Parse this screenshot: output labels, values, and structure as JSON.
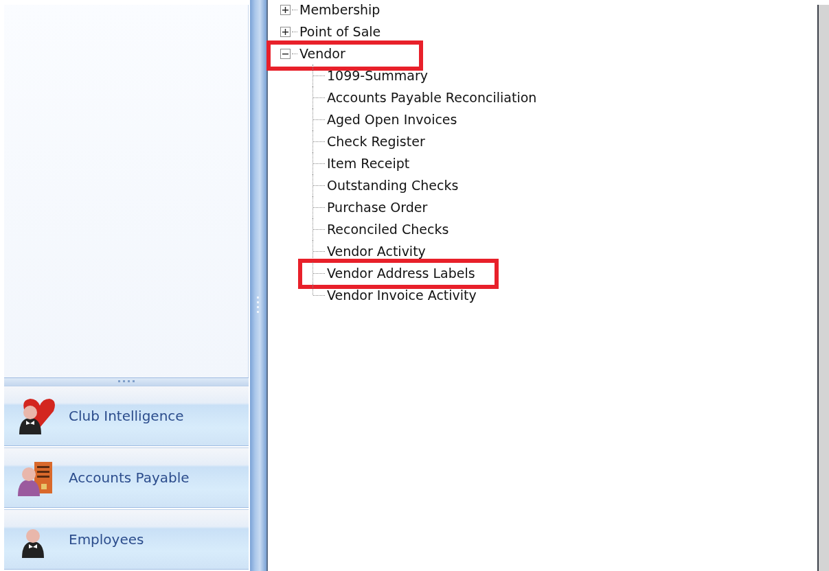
{
  "tree": [
    {
      "label": "Membership",
      "expanded": false,
      "highlighted": false
    },
    {
      "label": "Point of Sale",
      "expanded": false,
      "highlighted": false
    },
    {
      "label": "Vendor",
      "expanded": true,
      "highlighted": true,
      "children": [
        {
          "label": "1099-Summary",
          "highlighted": false
        },
        {
          "label": "Accounts Payable Reconciliation",
          "highlighted": false
        },
        {
          "label": "Aged Open Invoices",
          "highlighted": false
        },
        {
          "label": "Check Register",
          "highlighted": false
        },
        {
          "label": "Item Receipt",
          "highlighted": false
        },
        {
          "label": "Outstanding Checks",
          "highlighted": false
        },
        {
          "label": "Purchase Order",
          "highlighted": false
        },
        {
          "label": "Reconciled Checks",
          "highlighted": false
        },
        {
          "label": "Vendor Activity",
          "highlighted": false
        },
        {
          "label": "Vendor Address Labels",
          "highlighted": true
        },
        {
          "label": "Vendor Invoice Activity",
          "highlighted": false
        }
      ]
    }
  ],
  "nav_buttons": [
    {
      "label": "Club Intelligence",
      "kind": "heart"
    },
    {
      "label": "Accounts Payable",
      "kind": "building"
    },
    {
      "label": "Employees",
      "kind": "person"
    }
  ]
}
